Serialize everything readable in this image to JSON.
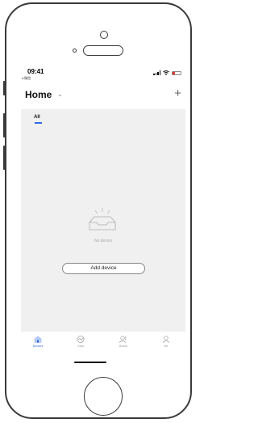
{
  "status_bar": {
    "time": "09:41",
    "back_app": "◂ 微信"
  },
  "header": {
    "title": "Home",
    "chevron": "⌄",
    "add_icon": "+"
  },
  "tabs": {
    "all_label": "All"
  },
  "empty_state": {
    "message": "No device",
    "add_button_label": "Add device"
  },
  "tabbar": {
    "items": [
      {
        "label": "Devices",
        "icon": "home-icon",
        "active": true
      },
      {
        "label": "Data",
        "icon": "data-icon",
        "active": false
      },
      {
        "label": "Buddy",
        "icon": "buddy-icon",
        "active": false
      },
      {
        "label": "Me",
        "icon": "person-icon",
        "active": false
      }
    ]
  },
  "colors": {
    "accent": "#2d6ae0",
    "content_bg": "#f0f0f0"
  }
}
